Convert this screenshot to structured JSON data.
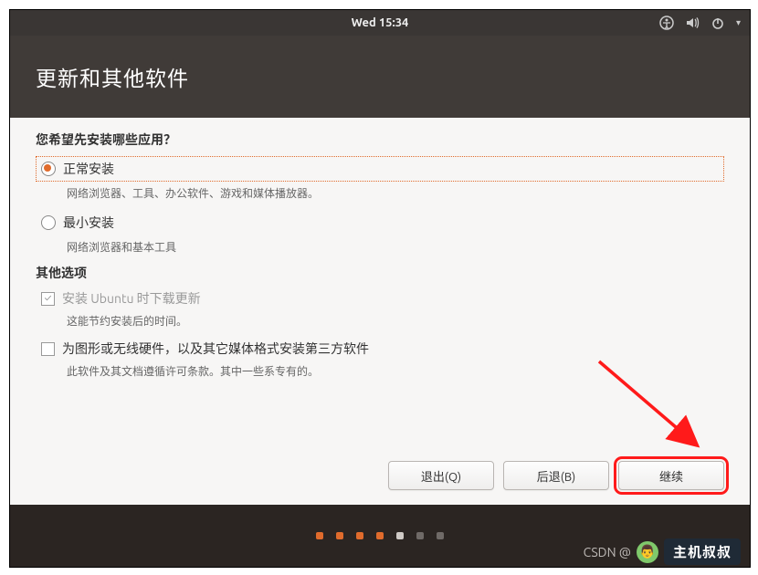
{
  "panel": {
    "time": "Wed 15:34"
  },
  "header": {
    "title": "更新和其他软件"
  },
  "q1": {
    "question": "您希望先安装哪些应用？",
    "opt_normal": {
      "label": "正常安装",
      "hint": "网络浏览器、工具、办公软件、游戏和媒体播放器。"
    },
    "opt_min": {
      "label": "最小安装",
      "hint": "网络浏览器和基本工具"
    }
  },
  "other": {
    "title": "其他选项",
    "download_updates": {
      "label": "安装 Ubuntu 时下载更新",
      "hint": "这能节约安装后的时间。"
    },
    "third_party": {
      "label": "为图形或无线硬件，以及其它媒体格式安装第三方软件",
      "hint": "此软件及其文档遵循许可条款。其中一些系专有的。"
    }
  },
  "buttons": {
    "quit": "退出(Q)",
    "back": "后退(B)",
    "continue": "继续"
  },
  "watermark": {
    "left": "CSDN @",
    "brand": "主机叔叔"
  }
}
